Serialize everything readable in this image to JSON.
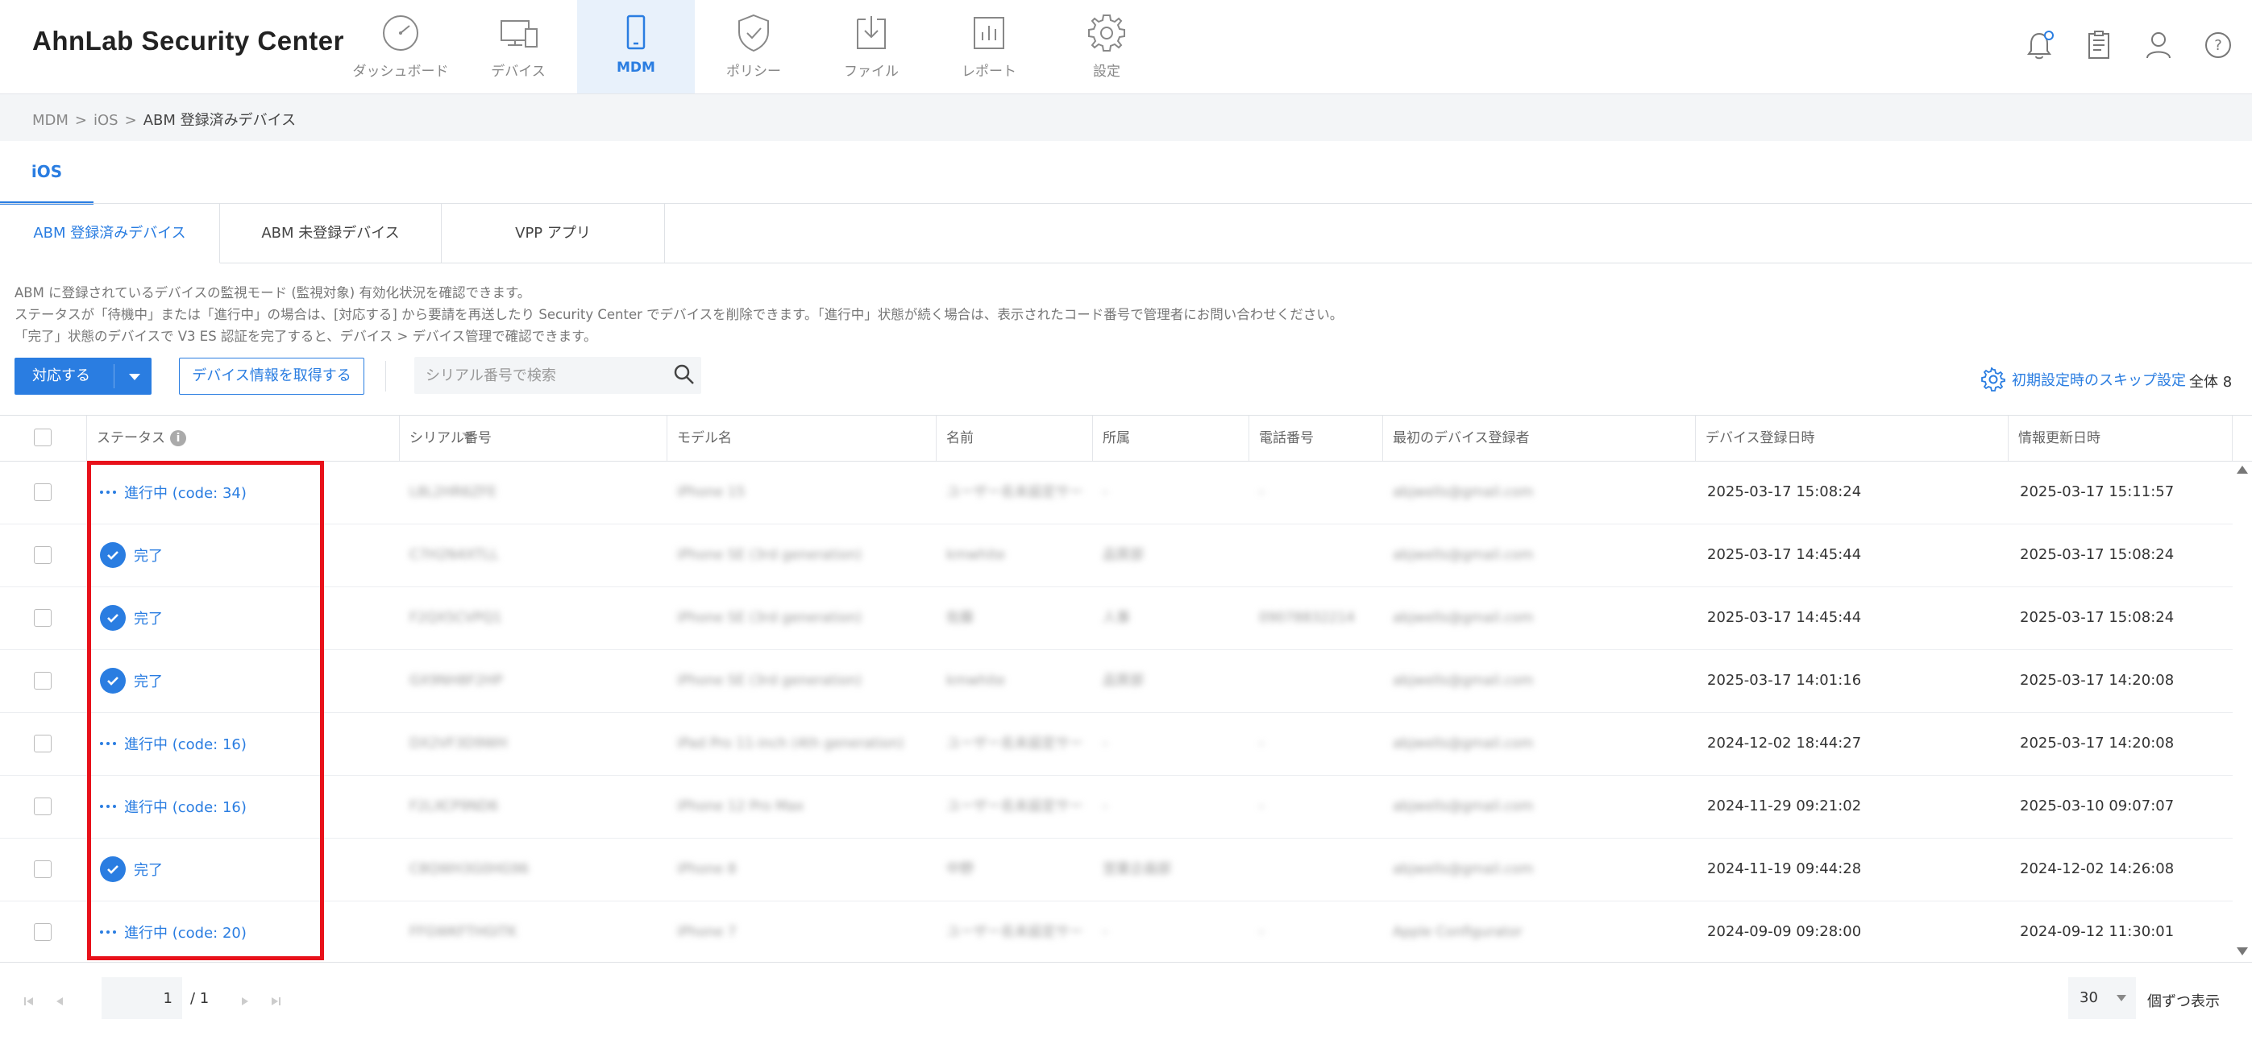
{
  "app": {
    "title": "AhnLab Security Center"
  },
  "nav": [
    {
      "label": "ダッシュボード",
      "icon": "dashboard-gauge-icon",
      "active": false
    },
    {
      "label": "デバイス",
      "icon": "devices-icon",
      "active": false
    },
    {
      "label": "MDM",
      "icon": "mobile-phone-icon",
      "active": true
    },
    {
      "label": "ポリシー",
      "icon": "shield-check-icon",
      "active": false
    },
    {
      "label": "ファイル",
      "icon": "file-download-icon",
      "active": false
    },
    {
      "label": "レポート",
      "icon": "report-chart-icon",
      "active": false
    },
    {
      "label": "設定",
      "icon": "gear-icon",
      "active": false
    }
  ],
  "header_icons": [
    "bell-icon",
    "clipboard-icon",
    "user-icon",
    "help-icon"
  ],
  "breadcrumb": {
    "items": [
      "MDM",
      "iOS",
      "ABM 登録済みデバイス"
    ],
    "separator": ">"
  },
  "os_tab": {
    "label": "iOS"
  },
  "sub_tabs": [
    {
      "label": "ABM 登録済みデバイス",
      "active": true
    },
    {
      "label": "ABM 未登録デバイス",
      "active": false
    },
    {
      "label": "VPP アプリ",
      "active": false
    }
  ],
  "description": [
    "ABM に登録されているデバイスの監視モード (監視対象) 有効化状況を確認できます。",
    "ステータスが「待機中」または「進行中」の場合は、[対応する] から要請を再送したり Security Center でデバイスを削除できます。「進行中」状態が続く場合は、表示されたコード番号で管理者にお問い合わせください。",
    "「完了」状態のデバイスで V3 ES 認証を完了すると、デバイス > デバイス管理で確認できます。"
  ],
  "toolbar": {
    "action_label": "対応する",
    "fetch_label": "デバイス情報を取得する",
    "search_placeholder": "シリアル番号で検索",
    "skip_label": "初期設定時のスキップ設定",
    "total_label": "全体 8"
  },
  "table": {
    "columns": [
      "ステータス",
      "シリアル番号",
      "モデル名",
      "名前",
      "所属",
      "電話番号",
      "最初のデバイス登録者",
      "デバイス登録日時",
      "情報更新日時"
    ],
    "rows": [
      {
        "status": "進行中 (code: 34)",
        "state": "progress",
        "serial": "L8L2HR6ZFE",
        "model": "iPhone 15",
        "name": "ユーザー名未設定サー",
        "group": "-",
        "phone": "-",
        "registrar": "abjwells@gmail.com",
        "registered": "2025-03-17 15:08:24",
        "updated": "2025-03-17 15:11:57"
      },
      {
        "status": "完了",
        "state": "done",
        "serial": "C7H2N4XTLL",
        "model": "iPhone SE (3rd generation)",
        "name": "kmwhite",
        "group": "品質部",
        "phone": "",
        "registrar": "abjwells@gmail.com",
        "registered": "2025-03-17 14:45:44",
        "updated": "2025-03-17 15:08:24"
      },
      {
        "status": "完了",
        "state": "done",
        "serial": "F2QX5CVPQ1",
        "model": "iPhone SE (3rd generation)",
        "name": "佐藤",
        "group": "人事",
        "phone": "09078832214",
        "registrar": "abjwells@gmail.com",
        "registered": "2025-03-17 14:45:44",
        "updated": "2025-03-17 15:08:24"
      },
      {
        "status": "完了",
        "state": "done",
        "serial": "GX9NH8F2HP",
        "model": "iPhone SE (3rd generation)",
        "name": "kmwhite",
        "group": "品質部",
        "phone": "",
        "registrar": "abjwells@gmail.com",
        "registered": "2025-03-17 14:01:16",
        "updated": "2025-03-17 14:20:08"
      },
      {
        "status": "進行中 (code: 16)",
        "state": "progress",
        "serial": "DX2VF3D9WH",
        "model": "iPad Pro 11-inch (4th generation)",
        "name": "ユーザー名未設定サー",
        "group": "-",
        "phone": "-",
        "registrar": "abjwells@gmail.com",
        "registered": "2024-12-02 18:44:27",
        "updated": "2025-03-17 14:20:08"
      },
      {
        "status": "進行中 (code: 16)",
        "state": "progress",
        "serial": "F2LXCP9ND6",
        "model": "iPhone 12 Pro Max",
        "name": "ユーザー名未設定サー",
        "group": "-",
        "phone": "-",
        "registrar": "abjwells@gmail.com",
        "registered": "2024-11-29 09:21:02",
        "updated": "2025-03-10 09:07:07"
      },
      {
        "status": "完了",
        "state": "done",
        "serial": "C8QWH3G0HG96",
        "model": "iPhone 8",
        "name": "中野",
        "group": "営業企画部",
        "phone": "",
        "registrar": "abjwells@gmail.com",
        "registered": "2024-11-19 09:44:28",
        "updated": "2024-12-02 14:26:08"
      },
      {
        "status": "進行中 (code: 20)",
        "state": "progress",
        "serial": "FFGWKFTHGITK",
        "model": "iPhone 7",
        "name": "ユーザー名未設定サー",
        "group": "-",
        "phone": "-",
        "registrar": "Apple Configurator",
        "registered": "2024-09-09 09:28:00",
        "updated": "2024-09-12 11:30:01"
      }
    ]
  },
  "pagination": {
    "current": "1",
    "total": "/ 1",
    "per_page": "30",
    "per_page_label": "個ずつ表示"
  },
  "colors": {
    "accent": "#2a7de1",
    "highlight": "#e8111a"
  }
}
